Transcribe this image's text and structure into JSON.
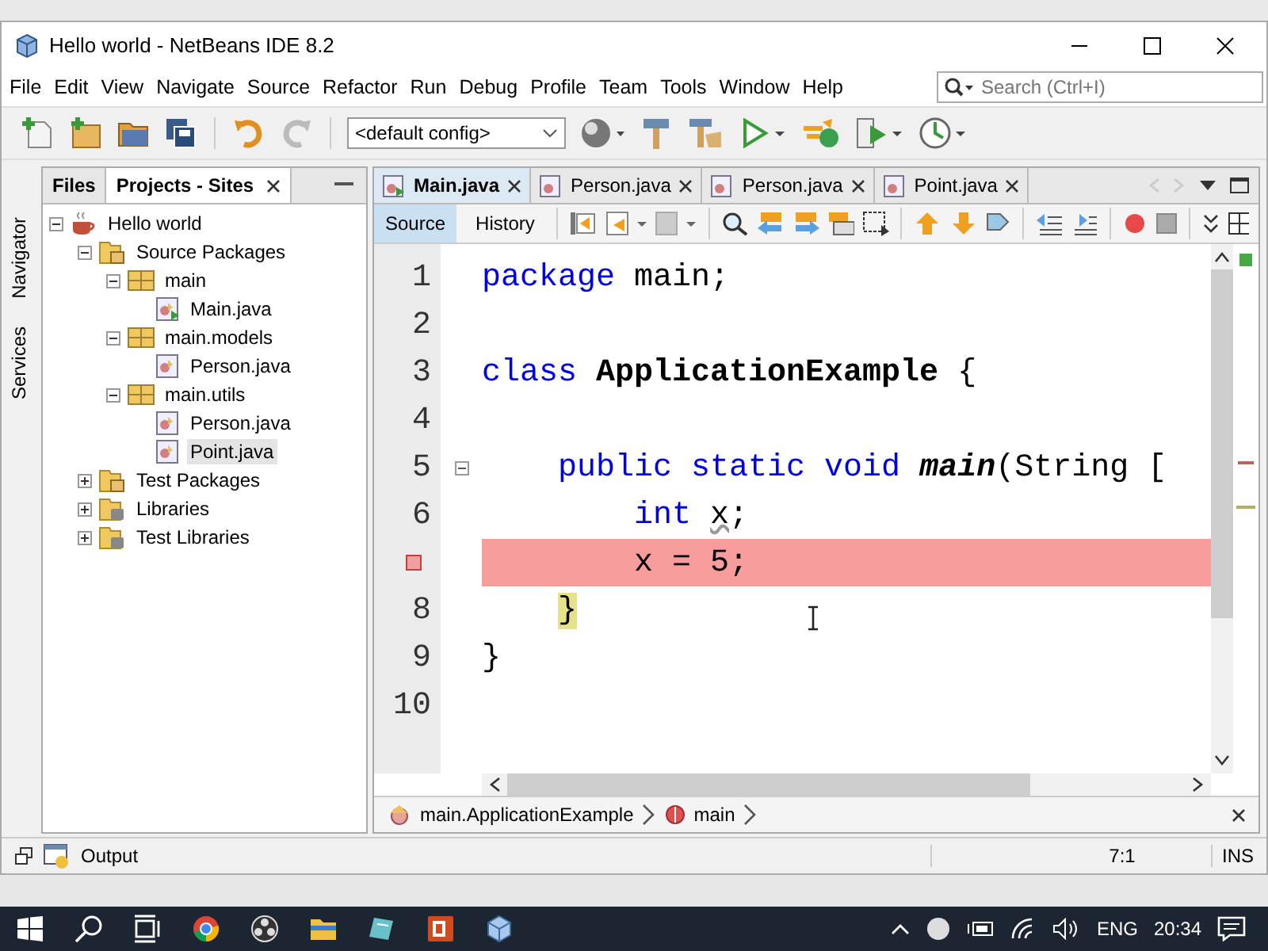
{
  "window": {
    "title": "Hello world - NetBeans IDE 8.2"
  },
  "menu": [
    "File",
    "Edit",
    "View",
    "Navigate",
    "Source",
    "Refactor",
    "Run",
    "Debug",
    "Profile",
    "Team",
    "Tools",
    "Window",
    "Help"
  ],
  "search": {
    "placeholder": "Search (Ctrl+I)"
  },
  "toolbar": {
    "config": "<default config>"
  },
  "side_strip": [
    "Navigator",
    "Services"
  ],
  "project_panel": {
    "tabs": [
      {
        "label": "Files",
        "selected": false
      },
      {
        "label": "Projects - Sites",
        "selected": true
      }
    ],
    "tree": [
      {
        "label": "Hello world",
        "kind": "project",
        "expanded": true,
        "selected": false,
        "children": [
          {
            "label": "Source Packages",
            "kind": "sources",
            "expanded": true,
            "selected": false,
            "children": [
              {
                "label": "main",
                "kind": "package",
                "expanded": true,
                "selected": false,
                "children": [
                  {
                    "label": "Main.java",
                    "kind": "main-class",
                    "selected": false
                  }
                ]
              },
              {
                "label": "main.models",
                "kind": "package",
                "expanded": true,
                "selected": false,
                "children": [
                  {
                    "label": "Person.java",
                    "kind": "class",
                    "selected": false
                  }
                ]
              },
              {
                "label": "main.utils",
                "kind": "package",
                "expanded": true,
                "selected": false,
                "children": [
                  {
                    "label": "Person.java",
                    "kind": "class",
                    "selected": false
                  },
                  {
                    "label": "Point.java",
                    "kind": "class",
                    "selected": true
                  }
                ]
              }
            ]
          },
          {
            "label": "Test Packages",
            "kind": "sources",
            "expanded": false,
            "selected": false
          },
          {
            "label": "Libraries",
            "kind": "library",
            "expanded": false,
            "selected": false
          },
          {
            "label": "Test Libraries",
            "kind": "library",
            "expanded": false,
            "selected": false
          }
        ]
      }
    ]
  },
  "editor": {
    "tabs": [
      {
        "label": "Main.java",
        "kind": "main-class",
        "selected": true
      },
      {
        "label": "Person.java",
        "kind": "class",
        "selected": false
      },
      {
        "label": "Person.java",
        "kind": "class",
        "selected": false
      },
      {
        "label": "Point.java",
        "kind": "class",
        "selected": false
      }
    ],
    "views": [
      {
        "label": "Source",
        "selected": true
      },
      {
        "label": "History",
        "selected": false
      }
    ],
    "lines": [
      {
        "number": "1",
        "breakpoint": false,
        "tokens": [
          {
            "text": "package",
            "kind": "keyword"
          },
          {
            "text": " main;",
            "kind": "plain"
          }
        ]
      },
      {
        "number": "2",
        "breakpoint": false
      },
      {
        "number": "3",
        "breakpoint": false,
        "tokens": [
          {
            "text": "class ",
            "kind": "keyword"
          },
          {
            "text": "ApplicationExample",
            "kind": "classname"
          },
          {
            "text": " {",
            "kind": "plain"
          }
        ]
      },
      {
        "number": "4",
        "breakpoint": false
      },
      {
        "number": "5",
        "breakpoint": false,
        "fold": true,
        "tokens": [
          {
            "text": "    public static void ",
            "kind": "keyword"
          },
          {
            "text": "main",
            "kind": "method"
          },
          {
            "text": "(String [",
            "kind": "plain"
          }
        ]
      },
      {
        "number": "6",
        "breakpoint": false,
        "tokens": [
          {
            "text": "        int ",
            "kind": "keyword"
          },
          {
            "text": "x",
            "kind": "warning"
          },
          {
            "text": ";",
            "kind": "plain"
          }
        ]
      },
      {
        "breakpoint": true,
        "tokens": [
          {
            "text": "        x = 5;",
            "kind": "plain"
          }
        ]
      },
      {
        "number": "8",
        "breakpoint": false,
        "tokens": [
          {
            "text": "    }",
            "kind": "matched"
          }
        ]
      },
      {
        "number": "9",
        "breakpoint": false,
        "tokens": [
          {
            "text": "}",
            "kind": "plain"
          }
        ]
      },
      {
        "number": "10",
        "breakpoint": false
      }
    ],
    "breadcrumbs": [
      {
        "label": "main.ApplicationExample",
        "kind": "class"
      },
      {
        "label": "main",
        "kind": "method"
      }
    ]
  },
  "status_bar": {
    "panel": "Output",
    "position": "7:1",
    "mode": "INS"
  },
  "taskbar": {
    "language": "ENG",
    "time": "20:34"
  }
}
